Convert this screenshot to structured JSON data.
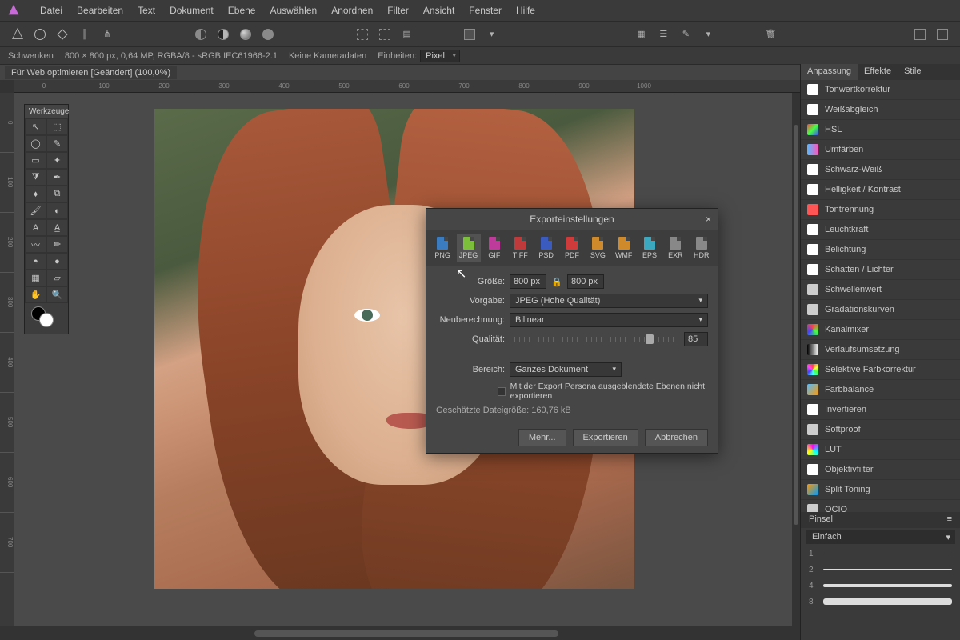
{
  "menu": [
    "Datei",
    "Bearbeiten",
    "Text",
    "Dokument",
    "Ebene",
    "Auswählen",
    "Anordnen",
    "Filter",
    "Ansicht",
    "Fenster",
    "Hilfe"
  ],
  "info": {
    "tool": "Schwenken",
    "doc": "800 × 800 px, 0,64 MP, RGBA/8 - sRGB IEC61966-2.1",
    "cam": "Keine Kameradaten",
    "units_lbl": "Einheiten:",
    "units_val": "Pixel"
  },
  "tab": {
    "name": "Für Web optimieren [Geändert] (100,0%)"
  },
  "tools_title": "Werkzeuge",
  "ruler_h": [
    "0",
    "100",
    "200",
    "300",
    "400",
    "500",
    "600",
    "700",
    "800",
    "900",
    "1000"
  ],
  "ruler_v": [
    "0",
    "100",
    "200",
    "300",
    "400",
    "500",
    "600",
    "700"
  ],
  "right_tabs": [
    "Anpassung",
    "Effekte",
    "Stile"
  ],
  "adjustments": [
    {
      "i": "◧",
      "c": "#fff",
      "t": "Tonwertkorrektur"
    },
    {
      "i": "◐",
      "c": "#fff",
      "t": "Weißabgleich"
    },
    {
      "i": "◆",
      "c": "linear-gradient(135deg,#f44,#4f4,#44f)",
      "t": "HSL"
    },
    {
      "i": "■",
      "c": "linear-gradient(90deg,#5bf,#f5b)",
      "t": "Umfärben"
    },
    {
      "i": "◩",
      "c": "#fff",
      "t": "Schwarz-Weiß"
    },
    {
      "i": "◐",
      "c": "#fff",
      "t": "Helligkeit / Kontrast"
    },
    {
      "i": "◩",
      "c": "#f55",
      "t": "Tontrennung"
    },
    {
      "i": "○",
      "c": "#fff",
      "t": "Leuchtkraft"
    },
    {
      "i": "◢",
      "c": "#fff",
      "t": "Belichtung"
    },
    {
      "i": "◩",
      "c": "#fff",
      "t": "Schatten / Lichter"
    },
    {
      "i": "▤",
      "c": "#ccc",
      "t": "Schwellenwert"
    },
    {
      "i": "∿",
      "c": "#ccc",
      "t": "Gradationskurven"
    },
    {
      "i": "◆",
      "c": "conic-gradient(#f44,#4f4,#44f,#f44)",
      "t": "Kanalmixer"
    },
    {
      "i": "▬",
      "c": "linear-gradient(90deg,#000,#fff)",
      "t": "Verlaufsumsetzung"
    },
    {
      "i": "✦",
      "c": "conic-gradient(#f44,#ff4,#4f4,#4ff,#44f,#f4f,#f44)",
      "t": "Selektive Farbkorrektur"
    },
    {
      "i": "◆",
      "c": "linear-gradient(135deg,#5bf,#f90)",
      "t": "Farbbalance"
    },
    {
      "i": "◪",
      "c": "#fff",
      "t": "Invertieren"
    },
    {
      "i": "◐",
      "c": "#ccc",
      "t": "Softproof"
    },
    {
      "i": "◆",
      "c": "conic-gradient(#f0f,#0ff,#ff0,#f0f)",
      "t": "LUT"
    },
    {
      "i": "●",
      "c": "#fff",
      "t": "Objektivfilter"
    },
    {
      "i": "◩",
      "c": "linear-gradient(135deg,#f90,#09f)",
      "t": "Split Toning"
    },
    {
      "i": "▣",
      "c": "#ccc",
      "t": "OCIO"
    }
  ],
  "pinsel": {
    "title": "Pinsel",
    "cat": "Einfach",
    "rows": [
      "1",
      "2",
      "4",
      "8"
    ]
  },
  "dialog": {
    "title": "Exporteinstellungen",
    "formats": [
      {
        "l": "PNG",
        "c": "#3b7bbf"
      },
      {
        "l": "JPEG",
        "c": "#7bbf3b"
      },
      {
        "l": "GIF",
        "c": "#bf3b9b"
      },
      {
        "l": "TIFF",
        "c": "#bf3b3b"
      },
      {
        "l": "PSD",
        "c": "#3b5bbf"
      },
      {
        "l": "PDF",
        "c": "#cf3b3b"
      },
      {
        "l": "SVG",
        "c": "#cf8a2b"
      },
      {
        "l": "WMF",
        "c": "#cf8a2b"
      },
      {
        "l": "EPS",
        "c": "#3ba8bf"
      },
      {
        "l": "EXR",
        "c": "#888"
      },
      {
        "l": "HDR",
        "c": "#888"
      }
    ],
    "sel_fmt": 1,
    "size_lbl": "Größe:",
    "w": "800 px",
    "h": "800 px",
    "preset_lbl": "Vorgabe:",
    "preset": "JPEG (Hohe Qualität)",
    "resample_lbl": "Neuberechnung:",
    "resample": "Bilinear",
    "quality_lbl": "Qualität:",
    "quality": "85",
    "area_lbl": "Bereich:",
    "area": "Ganzes Dokument",
    "chk_lbl": "Mit der Export Persona ausgeblendete Ebenen nicht exportieren",
    "est_lbl": "Geschätzte Dateigröße:",
    "est_val": "160,76 kB",
    "more": "Mehr...",
    "export": "Exportieren",
    "cancel": "Abbrechen"
  }
}
